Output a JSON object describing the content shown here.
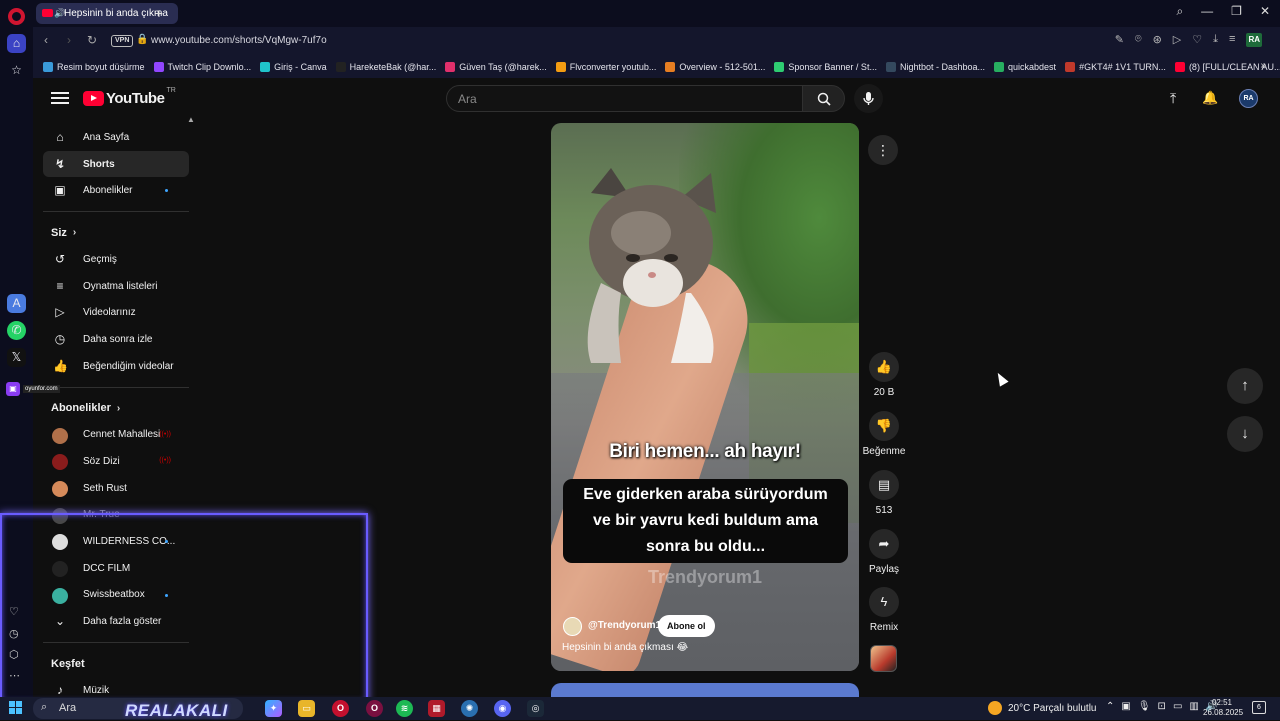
{
  "browser": {
    "tab_title": "Hepsinin bi anda çıkma",
    "url": "www.youtube.com/shorts/VqMgw-7uf7o",
    "vpn_label": "VPN",
    "bookmarks": [
      {
        "label": "Resim boyut düşürme",
        "color": "#3a9ad9"
      },
      {
        "label": "Twitch Clip Downlo...",
        "color": "#9146ff"
      },
      {
        "label": "Giriş - Canva",
        "color": "#20c4cb"
      },
      {
        "label": "HareketeBak (@har...",
        "color": "#222222"
      },
      {
        "label": "Güven Taş (@harek...",
        "color": "#e1306c"
      },
      {
        "label": "Flvconverter youtub...",
        "color": "#f39c12"
      },
      {
        "label": "Overview - 512-501...",
        "color": "#e67e22"
      },
      {
        "label": "Sponsor Banner / St...",
        "color": "#2ecc71"
      },
      {
        "label": "Nightbot - Dashboa...",
        "color": "#34495e"
      },
      {
        "label": "quickabdest",
        "color": "#27ae60"
      },
      {
        "label": "#GKT4# 1V1 TURN...",
        "color": "#c0392b"
      },
      {
        "label": "(8) [FULL/CLEAN AU...",
        "color": "#ff0033"
      }
    ]
  },
  "youtube": {
    "logo_text": "YouTube",
    "region": "TR",
    "search_placeholder": "Ara",
    "account_initials": "RA",
    "nav_main": [
      {
        "label": "Ana Sayfa",
        "icon": "home-icon",
        "glyph": "⌂"
      },
      {
        "label": "Shorts",
        "icon": "shorts-icon",
        "glyph": "↯"
      },
      {
        "label": "Abonelikler",
        "icon": "subscriptions-icon",
        "glyph": "▣"
      }
    ],
    "you_heading": "Siz",
    "nav_you": [
      {
        "label": "Geçmiş",
        "icon": "history-icon",
        "glyph": "↺"
      },
      {
        "label": "Oynatma listeleri",
        "icon": "playlists-icon",
        "glyph": "≡"
      },
      {
        "label": "Videolarınız",
        "icon": "your-videos-icon",
        "glyph": "▷"
      },
      {
        "label": "Daha sonra izle",
        "icon": "watch-later-icon",
        "glyph": "◷"
      },
      {
        "label": "Beğendiğim videolar",
        "icon": "liked-videos-icon",
        "glyph": "👍"
      }
    ],
    "subs_heading": "Abonelikler",
    "subscriptions": [
      {
        "label": "Cennet Mahallesi",
        "color": "#b0704a",
        "badge": "live"
      },
      {
        "label": "Söz Dizi",
        "color": "#8a1c1c",
        "badge": "live"
      },
      {
        "label": "Seth Rust",
        "color": "#d58a5a",
        "badge": ""
      },
      {
        "label": "Mr. True",
        "color": "#777777",
        "badge": ""
      },
      {
        "label": "WILDERNESS CO...",
        "color": "#dddddd",
        "badge": "dot"
      },
      {
        "label": "DCC FILM",
        "color": "#222222",
        "badge": ""
      },
      {
        "label": "Swissbeatbox",
        "color": "#3ab0a0",
        "badge": "dot"
      }
    ],
    "show_more": "Daha fazla göster",
    "explore_heading": "Keşfet",
    "explore_items": [
      {
        "label": "Müzik",
        "icon": "music-icon"
      }
    ]
  },
  "short": {
    "overlay_title": "Biri hemen... ah hayır!",
    "overlay_caption_lines": [
      "Eve giderken araba sürüyordum",
      "ve bir yavru kedi buldum ama",
      "sonra bu oldu..."
    ],
    "watermark": "Trendyorum1",
    "channel": "@Trendyorum1",
    "subscribe_label": "Abone ol",
    "caption": "Hepsinin bi anda çıkması 😂",
    "likes": "20 B",
    "dislike_label": "Beğenme",
    "comments": "513",
    "share_label": "Paylaş",
    "remix_label": "Remix"
  },
  "overlay": {
    "twitch_name": "oyunfor.com",
    "streamer_name": "REALAKALI"
  },
  "taskbar": {
    "search_label": "Ara",
    "weather": "20°C  Parçalı bulutlu",
    "time": "02:51",
    "date": "26.08.2025",
    "notif_count": "6"
  }
}
